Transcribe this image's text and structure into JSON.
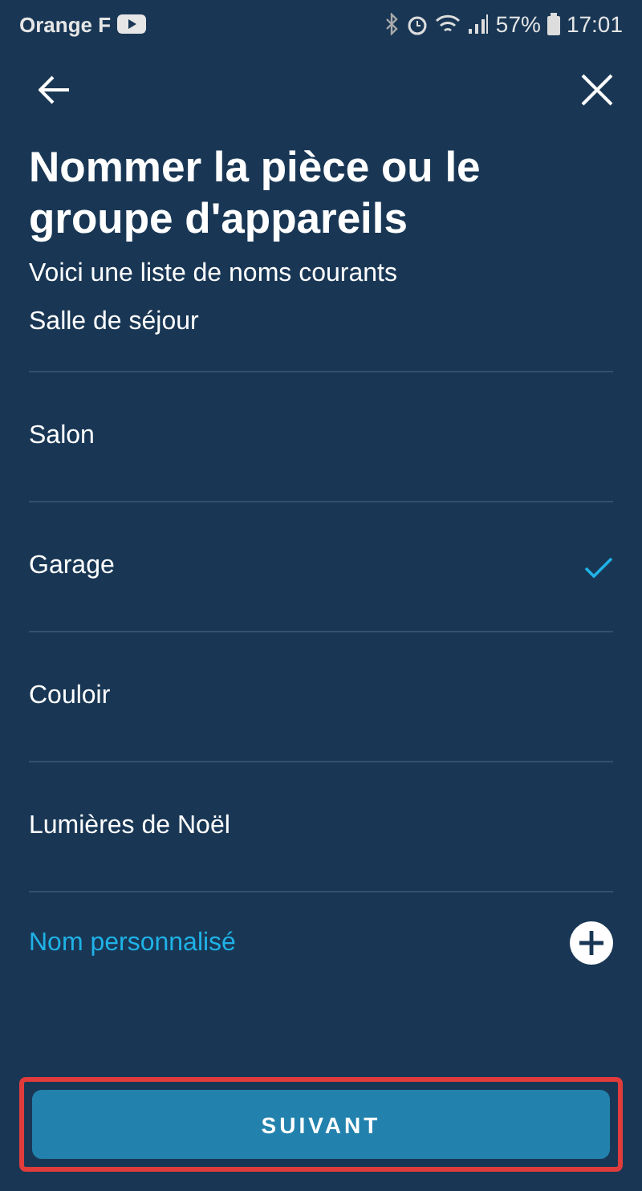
{
  "status_bar": {
    "carrier": "Orange F",
    "battery": "57%",
    "time": "17:01"
  },
  "title": "Nommer la pièce ou le groupe d'appareils",
  "subtitle": "Voici une liste de noms courants",
  "items": [
    {
      "label": "Salle de séjour",
      "selected": false
    },
    {
      "label": "Salon",
      "selected": false
    },
    {
      "label": "Garage",
      "selected": true
    },
    {
      "label": "Couloir",
      "selected": false
    },
    {
      "label": "Lumières de Noël",
      "selected": false
    }
  ],
  "custom": {
    "label": "Nom personnalisé"
  },
  "button": {
    "label": "SUIVANT",
    "highlighted": true
  }
}
